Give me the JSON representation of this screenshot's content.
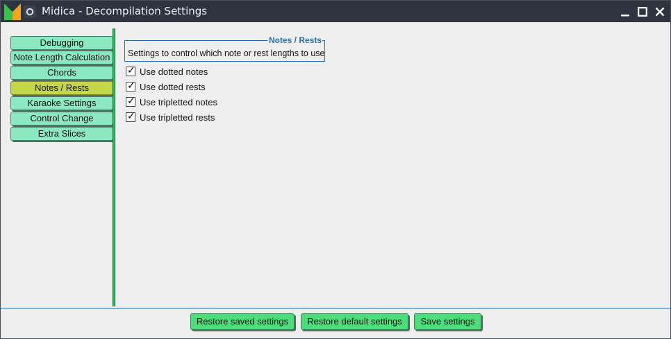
{
  "window": {
    "title": "Midica - Decompilation Settings"
  },
  "titlebar_icons": {
    "app": "midica-logo-icon",
    "shade": "window-shade-icon",
    "minimize": "minimize-icon",
    "maximize": "maximize-icon",
    "close": "close-icon"
  },
  "sidebar": {
    "items": [
      {
        "label": "Debugging"
      },
      {
        "label": "Note Length Calculation"
      },
      {
        "label": "Chords"
      },
      {
        "label": "Notes / Rests"
      },
      {
        "label": "Karaoke Settings"
      },
      {
        "label": "Control Change"
      },
      {
        "label": "Extra Slices"
      }
    ],
    "selected": "Notes / Rests"
  },
  "panel": {
    "group_title": "Notes / Rests",
    "group_description": "Settings to control which note or rest lengths to use",
    "checkboxes": [
      {
        "label": "Use dotted notes",
        "checked": true
      },
      {
        "label": "Use dotted rests",
        "checked": true
      },
      {
        "label": "Use tripletted notes",
        "checked": true
      },
      {
        "label": "Use tripletted rests",
        "checked": true
      }
    ],
    "check_mark": "✓"
  },
  "footer": {
    "restore_saved": "Restore saved settings",
    "restore_default": "Restore default settings",
    "save": "Save settings"
  },
  "colors": {
    "titlebar": "#2e3440",
    "nav_item": "#8ce8c0",
    "nav_item_active": "#c5d648",
    "accent_green": "#27c458",
    "accent_blue": "#2a6fa8",
    "button": "#4fdc7e"
  }
}
